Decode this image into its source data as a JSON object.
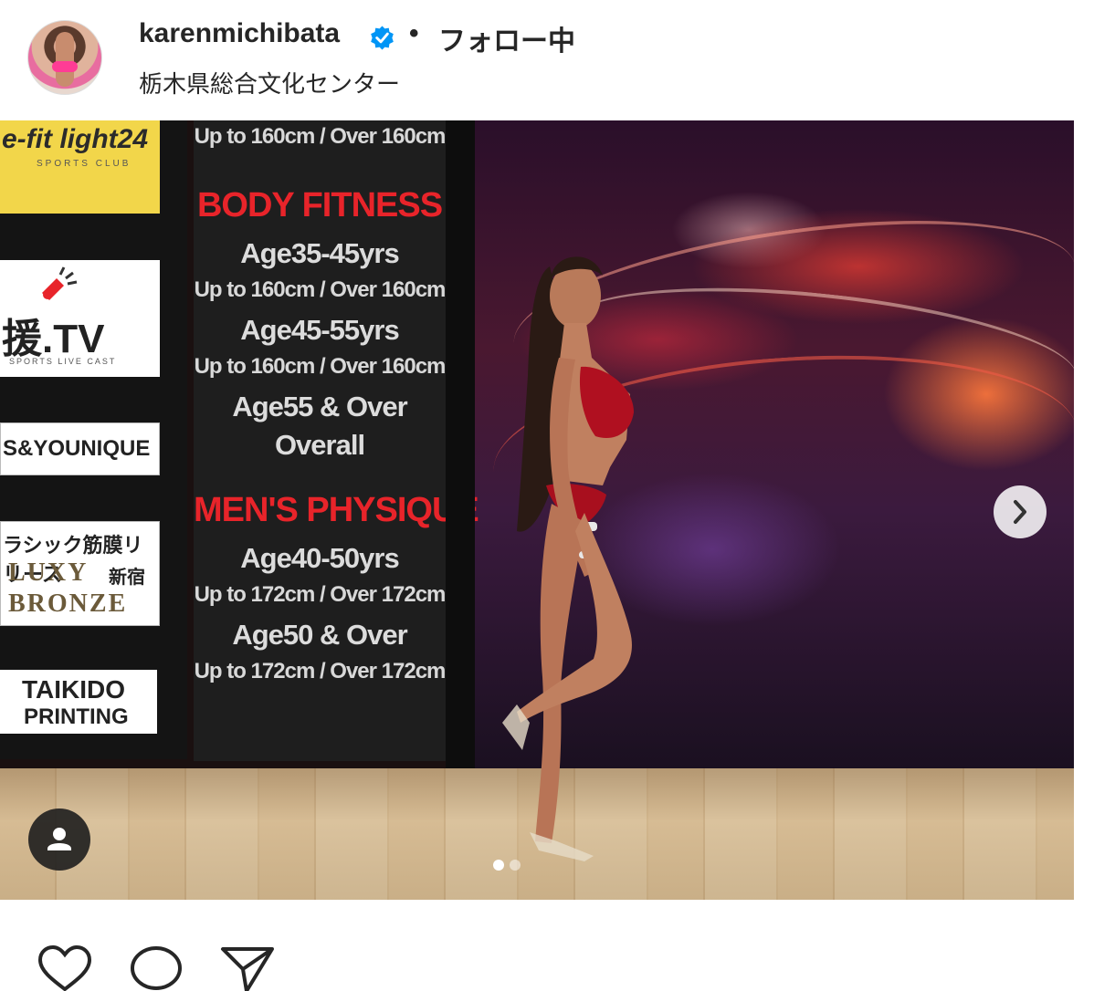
{
  "post": {
    "username": "karenmichibata",
    "verified": true,
    "separator": "•",
    "follow_status": "フォロー中",
    "location": "栃木県総合文化センター"
  },
  "media": {
    "carousel_dots": 2,
    "active_dot": 0,
    "sponsors": {
      "s1_title": "e-fit light24",
      "s1_sub": "SPORTS CLUB",
      "s2_title": "援.TV",
      "s2_sub": "SPORTS LIVE CAST",
      "s3_title": "S&YOUNIQUE",
      "s4_line1": "ラシック筋膜リリース",
      "s4_line2": "LUXY",
      "s4_line3": "新宿",
      "s4_line4": "BRONZE",
      "s5_line1": "TAIKIDO",
      "s5_line2": "PRINTING"
    },
    "categories": [
      "Up to 160cm / Over 160cm",
      "BODY FITNESS",
      "Age35-45yrs",
      "Up to 160cm / Over 160cm",
      "Age45-55yrs",
      "Up to 160cm / Over 160cm",
      "Age55 & Over",
      "Overall",
      "MEN'S PHYSIQUE",
      "Age40-50yrs",
      "Up to 172cm / Over 172cm",
      "Age50 & Over",
      "Up to 172cm / Over 172cm"
    ]
  },
  "icons": {
    "verified": "verified-badge-icon",
    "next": "chevron-right-icon",
    "user_tag": "user-tag-icon",
    "like": "heart-icon",
    "comment": "comment-icon",
    "share": "share-icon"
  },
  "colors": {
    "verified_blue": "#0095f6",
    "text": "#262626",
    "stage_red": "#e8242a"
  }
}
